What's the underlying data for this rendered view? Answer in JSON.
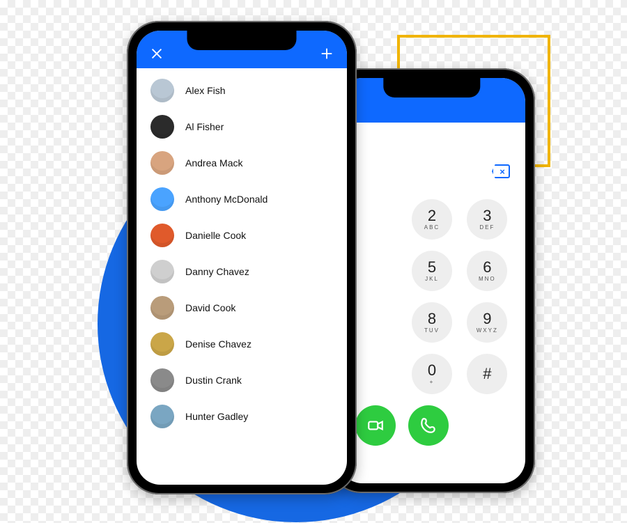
{
  "colors": {
    "accent_blue": "#0E69FF",
    "circle_blue": "#1668E3",
    "accent_yellow": "#F0B400",
    "call_green": "#2ECC40",
    "key_grey": "#EEEEEE"
  },
  "contacts": [
    {
      "name": "Alex Fish",
      "avatar_bg": "#b9c7d4"
    },
    {
      "name": "Al Fisher",
      "avatar_bg": "#2b2b2b"
    },
    {
      "name": "Andrea Mack",
      "avatar_bg": "#d8a47f"
    },
    {
      "name": "Anthony McDonald",
      "avatar_bg": "#4aa3ff"
    },
    {
      "name": "Danielle Cook",
      "avatar_bg": "#e05a2b"
    },
    {
      "name": "Danny Chavez",
      "avatar_bg": "#cfcfcf"
    },
    {
      "name": "David Cook",
      "avatar_bg": "#b99c7a"
    },
    {
      "name": "Denise Chavez",
      "avatar_bg": "#caa648"
    },
    {
      "name": "Dustin Crank",
      "avatar_bg": "#8a8a8a"
    },
    {
      "name": "Hunter Gadley",
      "avatar_bg": "#7aa6c2"
    }
  ],
  "dialer": {
    "keys": [
      {
        "digit": "2",
        "letters": "ABC"
      },
      {
        "digit": "3",
        "letters": "DEF"
      },
      {
        "digit": "5",
        "letters": "JKL"
      },
      {
        "digit": "6",
        "letters": "MNO"
      },
      {
        "digit": "8",
        "letters": "TUV"
      },
      {
        "digit": "9",
        "letters": "WXYZ"
      },
      {
        "digit": "0",
        "letters": "+"
      },
      {
        "digit": "#",
        "letters": ""
      }
    ],
    "actions": {
      "video": "video-call",
      "voice": "voice-call"
    },
    "backspace": "×"
  },
  "header_icons": {
    "close": "close-icon",
    "add": "plus-icon"
  }
}
